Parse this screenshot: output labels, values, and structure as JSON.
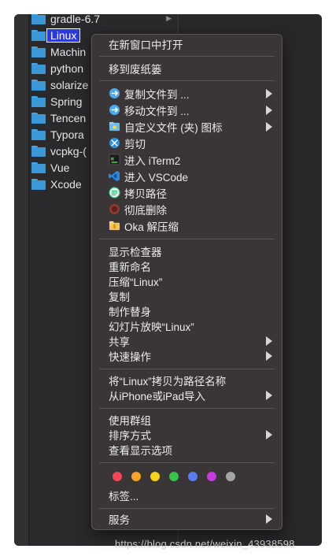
{
  "finder": {
    "folders": [
      {
        "name": "gradle-6.7"
      },
      {
        "name": "Linux"
      },
      {
        "name": "Machin"
      },
      {
        "name": "python"
      },
      {
        "name": "solarize"
      },
      {
        "name": "Spring"
      },
      {
        "name": "Tencen"
      },
      {
        "name": "Typora"
      },
      {
        "name": "vcpkg-("
      },
      {
        "name": "Vue"
      },
      {
        "name": "Xcode"
      }
    ],
    "selected_index": 1
  },
  "menu": {
    "open_new_window": "在新窗口中打开",
    "move_to_trash": "移到废纸篓",
    "copy_file_to": "复制文件到 ...",
    "move_file_to": "移动文件到 ...",
    "custom_icon": "自定义文件 (夹) 图标",
    "cut": "剪切",
    "enter_iterm2": "进入 iTerm2",
    "enter_vscode": "进入 VSCode",
    "copy_path": "拷贝路径",
    "delete_permanently": "彻底删除",
    "oka_unzip": "Oka 解压缩",
    "get_info": "显示检查器",
    "rename": "重新命名",
    "compress": "压缩“Linux”",
    "duplicate": "复制",
    "make_alias": "制作替身",
    "slideshow": "幻灯片放映“Linux”",
    "share": "共享",
    "quick_actions": "快速操作",
    "copy_as_pathname": "将“Linux”拷贝为路径名称",
    "import_from_iphone": "从iPhone或iPad导入",
    "use_groups": "使用群组",
    "sort_by": "排序方式",
    "show_view_options": "查看显示选项",
    "tags": "标签...",
    "services": "服务",
    "tag_colors": [
      "#f2475b",
      "#f7a22a",
      "#f6d21e",
      "#36c34e",
      "#5b7cf0",
      "#c63ae0",
      "#a4a4a6"
    ]
  },
  "watermark": "https://blog.csdn.net/weixin_43938598"
}
